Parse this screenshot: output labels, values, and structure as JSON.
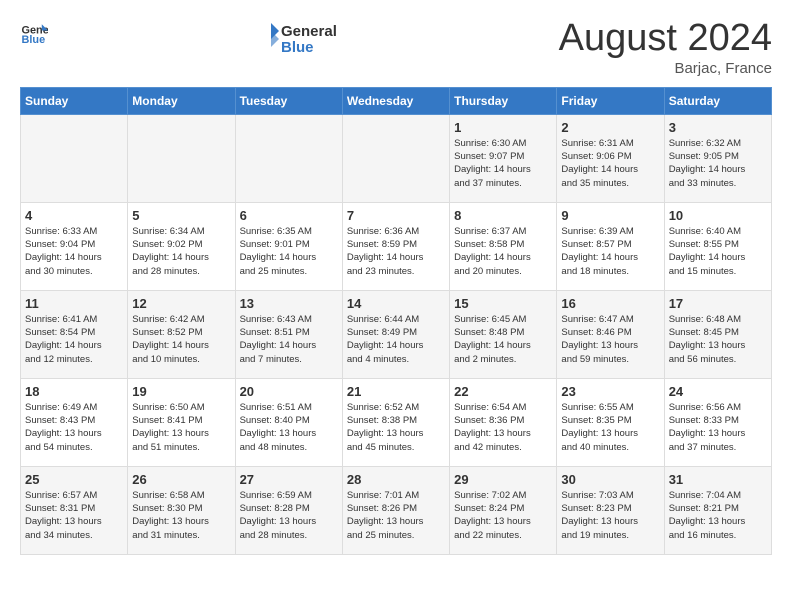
{
  "header": {
    "logo_general": "General",
    "logo_blue": "Blue",
    "main_title": "August 2024",
    "subtitle": "Barjac, France"
  },
  "calendar": {
    "weekdays": [
      "Sunday",
      "Monday",
      "Tuesday",
      "Wednesday",
      "Thursday",
      "Friday",
      "Saturday"
    ],
    "weeks": [
      [
        {
          "day": "",
          "info": ""
        },
        {
          "day": "",
          "info": ""
        },
        {
          "day": "",
          "info": ""
        },
        {
          "day": "",
          "info": ""
        },
        {
          "day": "1",
          "info": "Sunrise: 6:30 AM\nSunset: 9:07 PM\nDaylight: 14 hours\nand 37 minutes."
        },
        {
          "day": "2",
          "info": "Sunrise: 6:31 AM\nSunset: 9:06 PM\nDaylight: 14 hours\nand 35 minutes."
        },
        {
          "day": "3",
          "info": "Sunrise: 6:32 AM\nSunset: 9:05 PM\nDaylight: 14 hours\nand 33 minutes."
        }
      ],
      [
        {
          "day": "4",
          "info": "Sunrise: 6:33 AM\nSunset: 9:04 PM\nDaylight: 14 hours\nand 30 minutes."
        },
        {
          "day": "5",
          "info": "Sunrise: 6:34 AM\nSunset: 9:02 PM\nDaylight: 14 hours\nand 28 minutes."
        },
        {
          "day": "6",
          "info": "Sunrise: 6:35 AM\nSunset: 9:01 PM\nDaylight: 14 hours\nand 25 minutes."
        },
        {
          "day": "7",
          "info": "Sunrise: 6:36 AM\nSunset: 8:59 PM\nDaylight: 14 hours\nand 23 minutes."
        },
        {
          "day": "8",
          "info": "Sunrise: 6:37 AM\nSunset: 8:58 PM\nDaylight: 14 hours\nand 20 minutes."
        },
        {
          "day": "9",
          "info": "Sunrise: 6:39 AM\nSunset: 8:57 PM\nDaylight: 14 hours\nand 18 minutes."
        },
        {
          "day": "10",
          "info": "Sunrise: 6:40 AM\nSunset: 8:55 PM\nDaylight: 14 hours\nand 15 minutes."
        }
      ],
      [
        {
          "day": "11",
          "info": "Sunrise: 6:41 AM\nSunset: 8:54 PM\nDaylight: 14 hours\nand 12 minutes."
        },
        {
          "day": "12",
          "info": "Sunrise: 6:42 AM\nSunset: 8:52 PM\nDaylight: 14 hours\nand 10 minutes."
        },
        {
          "day": "13",
          "info": "Sunrise: 6:43 AM\nSunset: 8:51 PM\nDaylight: 14 hours\nand 7 minutes."
        },
        {
          "day": "14",
          "info": "Sunrise: 6:44 AM\nSunset: 8:49 PM\nDaylight: 14 hours\nand 4 minutes."
        },
        {
          "day": "15",
          "info": "Sunrise: 6:45 AM\nSunset: 8:48 PM\nDaylight: 14 hours\nand 2 minutes."
        },
        {
          "day": "16",
          "info": "Sunrise: 6:47 AM\nSunset: 8:46 PM\nDaylight: 13 hours\nand 59 minutes."
        },
        {
          "day": "17",
          "info": "Sunrise: 6:48 AM\nSunset: 8:45 PM\nDaylight: 13 hours\nand 56 minutes."
        }
      ],
      [
        {
          "day": "18",
          "info": "Sunrise: 6:49 AM\nSunset: 8:43 PM\nDaylight: 13 hours\nand 54 minutes."
        },
        {
          "day": "19",
          "info": "Sunrise: 6:50 AM\nSunset: 8:41 PM\nDaylight: 13 hours\nand 51 minutes."
        },
        {
          "day": "20",
          "info": "Sunrise: 6:51 AM\nSunset: 8:40 PM\nDaylight: 13 hours\nand 48 minutes."
        },
        {
          "day": "21",
          "info": "Sunrise: 6:52 AM\nSunset: 8:38 PM\nDaylight: 13 hours\nand 45 minutes."
        },
        {
          "day": "22",
          "info": "Sunrise: 6:54 AM\nSunset: 8:36 PM\nDaylight: 13 hours\nand 42 minutes."
        },
        {
          "day": "23",
          "info": "Sunrise: 6:55 AM\nSunset: 8:35 PM\nDaylight: 13 hours\nand 40 minutes."
        },
        {
          "day": "24",
          "info": "Sunrise: 6:56 AM\nSunset: 8:33 PM\nDaylight: 13 hours\nand 37 minutes."
        }
      ],
      [
        {
          "day": "25",
          "info": "Sunrise: 6:57 AM\nSunset: 8:31 PM\nDaylight: 13 hours\nand 34 minutes."
        },
        {
          "day": "26",
          "info": "Sunrise: 6:58 AM\nSunset: 8:30 PM\nDaylight: 13 hours\nand 31 minutes."
        },
        {
          "day": "27",
          "info": "Sunrise: 6:59 AM\nSunset: 8:28 PM\nDaylight: 13 hours\nand 28 minutes."
        },
        {
          "day": "28",
          "info": "Sunrise: 7:01 AM\nSunset: 8:26 PM\nDaylight: 13 hours\nand 25 minutes."
        },
        {
          "day": "29",
          "info": "Sunrise: 7:02 AM\nSunset: 8:24 PM\nDaylight: 13 hours\nand 22 minutes."
        },
        {
          "day": "30",
          "info": "Sunrise: 7:03 AM\nSunset: 8:23 PM\nDaylight: 13 hours\nand 19 minutes."
        },
        {
          "day": "31",
          "info": "Sunrise: 7:04 AM\nSunset: 8:21 PM\nDaylight: 13 hours\nand 16 minutes."
        }
      ]
    ]
  }
}
